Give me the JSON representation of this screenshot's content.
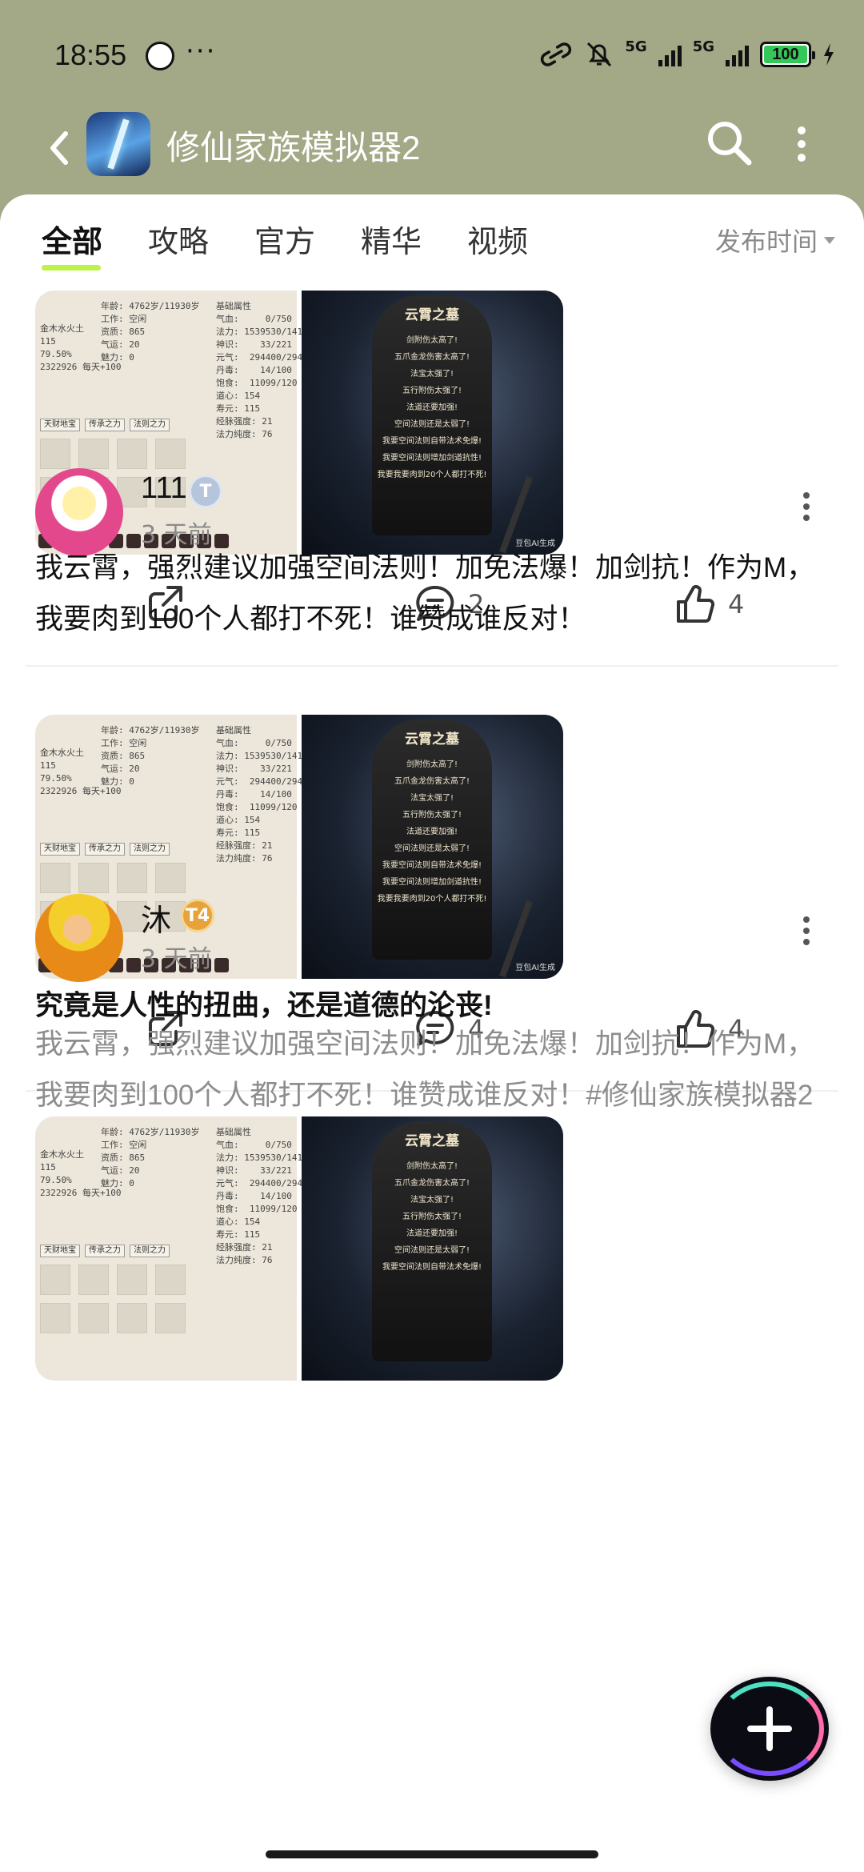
{
  "status_bar": {
    "time": "18:55",
    "more": "···",
    "signal1_label": "5G",
    "signal2_label": "5G",
    "battery": "100"
  },
  "header": {
    "title": "修仙家族模拟器2"
  },
  "tabs": [
    {
      "label": "全部"
    },
    {
      "label": "攻略"
    },
    {
      "label": "官方"
    },
    {
      "label": "精华"
    },
    {
      "label": "视频"
    }
  ],
  "sort_label": "发布时间",
  "stone_image": {
    "title": "云霄之墓",
    "lines": [
      "剑附伤太高了!",
      "五爪金龙伤害太高了!",
      "法宝太强了!",
      "五行附伤太强了!",
      "法道还要加强!",
      "空间法则还是太弱了!",
      "我要空间法则自带法术免爆!",
      "我要空间法则增加剑道抗性!",
      "我要我要肉到20个人都打不死!"
    ],
    "ai_tag": "豆包AI生成"
  },
  "stats_image": {
    "left_col": "年龄: 4762岁/11930岁\n工作: 空闲\n资质: 865\n气运: 20\n魅力: 0",
    "left_small": "金木水火土\n115\n79.50%\n2322926 每天+100",
    "right_col": "基础属性\n气血:     0/750\n法力: 1539530/141\n神识:    33/221\n元气:  294400/294\n丹毒:    14/100\n饱食:  11099/120\n道心: 154\n寿元: 115\n经脉强度: 21\n法力纯度: 76",
    "buttons": [
      "天财地宝",
      "传承之力",
      "法则之力"
    ]
  },
  "posts": [
    {
      "comments": "2",
      "likes": "4"
    },
    {
      "username": "111",
      "badge": "T",
      "time": "3 天前",
      "text": "我云霄，强烈建议加强空间法则！加免法爆！加剑抗！作为M，我要肉到100个人都打不死！谁赞成谁反对！",
      "comments": "4",
      "likes": "4"
    },
    {
      "username": "沐",
      "badge": "T4",
      "time": "3 天前",
      "title": "究竟是人性的扭曲，还是道德的沦丧!",
      "text": "我云霄，强烈建议加强空间法则！加免法爆！加剑抗！作为M，我要肉到100个人都打不死！谁赞成谁反对！#修仙家族模拟器2"
    }
  ],
  "icons": {
    "back": "back-arrow-icon",
    "search": "search-icon",
    "menu": "more-vertical-icon",
    "share": "share-icon",
    "comment": "comment-icon",
    "like": "thumbs-up-icon",
    "fab": "plus-icon"
  },
  "colors": {
    "header_bg": "#a3a886",
    "tab_underline": "#bdf247",
    "battery_fill": "#34c759"
  }
}
